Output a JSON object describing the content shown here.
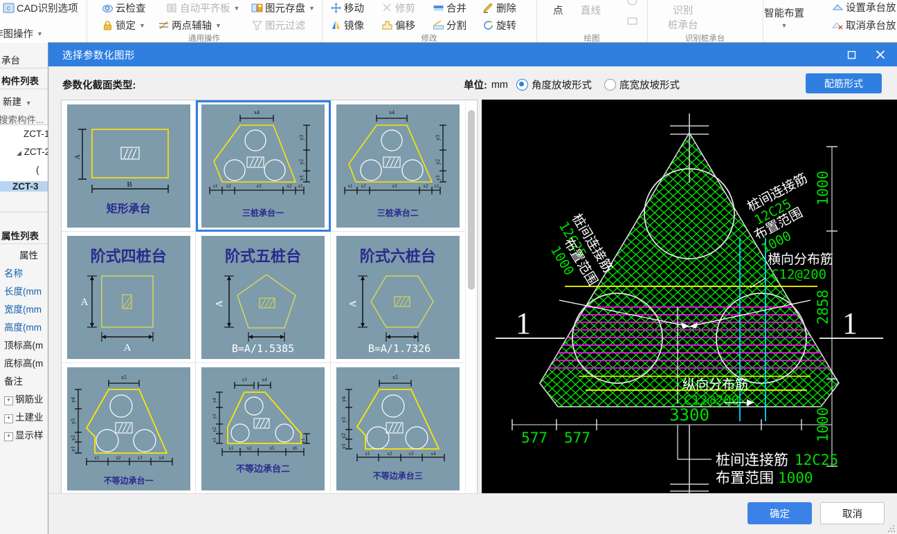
{
  "ribbon": {
    "groups": [
      {
        "label": "作图操作"
      },
      {
        "label": "通用操作"
      },
      {
        "label": "修改"
      },
      {
        "label": "绘图"
      },
      {
        "label": "识别桩承台"
      },
      {
        "label": ""
      }
    ],
    "items": [
      {
        "name": "cad-recognize-options",
        "label": "CAD识别选项",
        "icon": "cad-icon",
        "dim": false
      },
      {
        "name": "zuotu-caozuo",
        "label": "作图操作",
        "icon": "none",
        "caret": true,
        "dim": false
      },
      {
        "name": "cloud-check",
        "label": "云检查",
        "icon": "cloud-icon",
        "dim": false
      },
      {
        "name": "auto-flat-slab",
        "label": "自动平齐板",
        "icon": "slab-icon",
        "caret": true,
        "dim": true
      },
      {
        "name": "element-storage",
        "label": "图元存盘",
        "icon": "save-icon",
        "caret": true,
        "dim": false
      },
      {
        "name": "lock",
        "label": "锁定",
        "icon": "lock-icon",
        "caret": true,
        "dim": false
      },
      {
        "name": "two-point-axis",
        "label": "两点辅轴",
        "icon": "axis-icon",
        "caret": true,
        "dim": false
      },
      {
        "name": "element-filter",
        "label": "图元过滤",
        "icon": "filter-icon",
        "dim": true
      },
      {
        "name": "move",
        "label": "移动",
        "icon": "move-icon",
        "dim": false
      },
      {
        "name": "trim",
        "label": "修剪",
        "icon": "trim-icon",
        "dim": true
      },
      {
        "name": "merge",
        "label": "合并",
        "icon": "merge-icon",
        "dim": false
      },
      {
        "name": "delete",
        "label": "删除",
        "icon": "delete-icon",
        "dim": false
      },
      {
        "name": "mirror",
        "label": "镜像",
        "icon": "mirror-icon",
        "dim": false
      },
      {
        "name": "offset",
        "label": "偏移",
        "icon": "offset-icon",
        "dim": false
      },
      {
        "name": "split",
        "label": "分割",
        "icon": "split-icon",
        "dim": false
      },
      {
        "name": "rotate",
        "label": "旋转",
        "icon": "rotate-icon",
        "dim": false
      }
    ],
    "stacks": [
      {
        "name": "draw-point",
        "lines": [
          "点"
        ],
        "dim": false
      },
      {
        "name": "draw-line",
        "lines": [
          "直线"
        ],
        "dim": true
      },
      {
        "name": "recognize-pile-cap",
        "lines": [
          "识别",
          "桩承台"
        ],
        "dim": true
      },
      {
        "name": "smart-layout",
        "lines": [
          "智能布置"
        ],
        "dim": false
      }
    ],
    "right_items": [
      {
        "name": "check-cap-placement",
        "label": "设置承台放",
        "dim": false
      },
      {
        "name": "cancel-cap-placement",
        "label": "取消承台放",
        "dim": false
      }
    ]
  },
  "leftdock": {
    "top_item": "作图操作",
    "module": "承台",
    "tab_components": "构件列表",
    "new_button": "新建",
    "search_placeholder": "搜索构件...",
    "tree": [
      {
        "label": "ZCT-1",
        "indent": 34,
        "selected": false,
        "arrow": false
      },
      {
        "label": "ZCT-2",
        "indent": 24,
        "selected": false,
        "arrow": true
      },
      {
        "label": "(",
        "indent": 50,
        "selected": false,
        "arrow": false
      },
      {
        "label": "ZCT-3",
        "indent": 18,
        "selected": true,
        "arrow": false
      }
    ],
    "tab_properties": "属性列表",
    "prop_header": "属性",
    "props": [
      {
        "label": "名称",
        "blue": true,
        "plus": false
      },
      {
        "label": "长度(mm",
        "blue": true,
        "plus": false
      },
      {
        "label": "宽度(mm",
        "blue": true,
        "plus": false
      },
      {
        "label": "高度(mm",
        "blue": true,
        "plus": false
      },
      {
        "label": "顶标高(m",
        "blue": false,
        "plus": false
      },
      {
        "label": "底标高(m",
        "blue": false,
        "plus": false
      },
      {
        "label": "备注",
        "blue": false,
        "plus": false
      },
      {
        "label": "钢筋业",
        "blue": false,
        "plus": true
      },
      {
        "label": "土建业",
        "blue": false,
        "plus": true
      },
      {
        "label": "显示样",
        "blue": false,
        "plus": true
      }
    ]
  },
  "dialog": {
    "title": "选择参数化图形",
    "section_label": "参数化截面类型:",
    "unit_label": "单位:",
    "unit_value": "mm",
    "radio_angle": "角度放坡形式",
    "radio_width": "底宽放坡形式",
    "radio_selected": "angle",
    "rebar_button": "配筋形式",
    "ok_button": "确定",
    "cancel_button": "取消",
    "maximize_tooltip": "最大化",
    "close_tooltip": "关闭",
    "accent_color": "#2f7fe0",
    "thumb_bg_color": "#7d9bab"
  },
  "thumbnails": [
    {
      "id": "rect-cap",
      "label": "矩形承台",
      "selected": false,
      "shape": "rect",
      "dims": [
        "A",
        "B"
      ]
    },
    {
      "id": "tri-cap-1",
      "label": "三桩承台一",
      "selected": true,
      "shape": "tri1",
      "dims": [
        "x4",
        "y3",
        "y2",
        "y1",
        "x1",
        "x2",
        "x3",
        "x2",
        "x1"
      ]
    },
    {
      "id": "tri-cap-2",
      "label": "三桩承台二",
      "selected": false,
      "shape": "tri2",
      "dims": [
        "x4",
        "y3",
        "y2",
        "y1",
        "x1",
        "x2",
        "x3",
        "x2",
        "x1"
      ]
    },
    {
      "id": "step-4pile",
      "label": "阶式四桩台",
      "selected": false,
      "shape": "sq",
      "dims": [
        "A",
        "A"
      ]
    },
    {
      "id": "step-5pile",
      "label": "阶式五桩台",
      "selected": false,
      "shape": "penta",
      "dims": [
        "A",
        "B=A/1.5385"
      ]
    },
    {
      "id": "step-6pile",
      "label": "阶式六桩台",
      "selected": false,
      "shape": "hexa",
      "dims": [
        "A",
        "B=A/1.7326"
      ]
    },
    {
      "id": "uneven-cap-1",
      "label": "不等边承台一",
      "selected": false,
      "shape": "un1",
      "dims": [
        "x5",
        "y4",
        "y3",
        "y2",
        "y1",
        "x1",
        "x2",
        "x3",
        "x4"
      ]
    },
    {
      "id": "uneven-cap-2",
      "label": "不等边承台二",
      "selected": false,
      "shape": "un2",
      "dims": [
        "x3",
        "x4",
        "y4",
        "y3",
        "y2",
        "y1",
        "x1",
        "x2",
        "x5",
        "x6"
      ]
    },
    {
      "id": "uneven-cap-3",
      "label": "不等边承台三",
      "selected": false,
      "shape": "un3",
      "dims": [
        "x5",
        "y4",
        "y3",
        "y2",
        "y1",
        "x1",
        "x2",
        "x3",
        "x4"
      ]
    }
  ],
  "cad": {
    "title": "三桩承台一",
    "annotations": {
      "left_rebar_name": "桩间连接筋",
      "left_rebar_spec": "12C25",
      "left_range_name": "布置范围",
      "left_range_value": "1000",
      "right_rebar_name": "桩间连接筋",
      "right_rebar_spec": "12C25",
      "right_range_name": "布置范围",
      "right_range_value": "1000",
      "transverse_name": "横向分布筋",
      "transverse_spec": "C12@200",
      "longitudinal_name": "纵向分布筋",
      "longitudinal_spec": "C12@200",
      "bottom_rebar_name": "桩间连接筋",
      "bottom_rebar_spec": "12C25",
      "bottom_range_name": "布置范围",
      "bottom_range_value": "1000"
    },
    "dimensions": {
      "right_top": "1000",
      "right_mid": "2858",
      "right_bottom": "1000",
      "bottom_total": "3300",
      "bottom_left_1": "577",
      "bottom_left_2": "577"
    },
    "section_mark_left": "1",
    "section_mark_right": "1",
    "colors": {
      "outline": "#d8d8d8",
      "hatch_green": "#00ff00",
      "rebar_magenta": "#ff00ff",
      "rebar_cyan": "#00e5ff",
      "rebar_yellow": "#ffff00",
      "dim_text": "#00e000",
      "background": "#000000"
    }
  }
}
